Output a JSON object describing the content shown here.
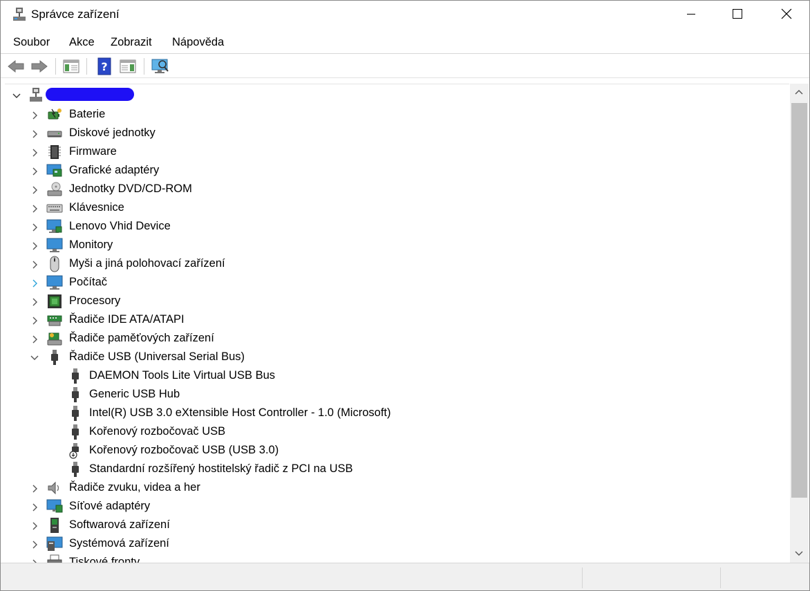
{
  "window": {
    "title": "Správce zařízení"
  },
  "menu": {
    "file": "Soubor",
    "action": "Akce",
    "view": "Zobrazit",
    "help": "Nápověda"
  },
  "tree": {
    "categories": [
      {
        "label": "Baterie",
        "icon": "battery-icon"
      },
      {
        "label": "Diskové jednotky",
        "icon": "disk-drive-icon"
      },
      {
        "label": "Firmware",
        "icon": "firmware-icon"
      },
      {
        "label": "Grafické adaptéry",
        "icon": "display-adapter-icon"
      },
      {
        "label": "Jednotky DVD/CD-ROM",
        "icon": "dvd-drive-icon"
      },
      {
        "label": "Klávesnice",
        "icon": "keyboard-icon"
      },
      {
        "label": "Lenovo Vhid Device",
        "icon": "monitor-network-icon"
      },
      {
        "label": "Monitory",
        "icon": "monitor-icon"
      },
      {
        "label": "Myši a jiná polohovací zařízení",
        "icon": "mouse-icon"
      },
      {
        "label": "Počítač",
        "icon": "computer-icon"
      },
      {
        "label": "Procesory",
        "icon": "processor-icon"
      },
      {
        "label": "Řadiče IDE ATA/ATAPI",
        "icon": "ide-controller-icon"
      },
      {
        "label": "Řadiče paměťových zařízení",
        "icon": "storage-controller-icon"
      },
      {
        "label": "Řadiče USB (Universal Serial Bus)",
        "icon": "usb-icon",
        "expanded": true
      },
      {
        "label": "Řadiče zvuku, videa a her",
        "icon": "speaker-icon"
      },
      {
        "label": "Síťové adaptéry",
        "icon": "network-adapter-icon"
      },
      {
        "label": "Softwarová zařízení",
        "icon": "software-device-icon"
      },
      {
        "label": "Systémová zařízení",
        "icon": "system-device-icon"
      },
      {
        "label": "Tiskové fronty",
        "icon": "printer-icon"
      }
    ],
    "usb_children": [
      {
        "label": "DAEMON Tools Lite Virtual USB Bus",
        "icon": "usb-plug-icon"
      },
      {
        "label": "Generic USB Hub",
        "icon": "usb-plug-icon"
      },
      {
        "label": "Intel(R) USB 3.0 eXtensible Host Controller - 1.0 (Microsoft)",
        "icon": "usb-plug-icon"
      },
      {
        "label": "Kořenový rozbočovač USB",
        "icon": "usb-plug-icon"
      },
      {
        "label": "Kořenový rozbočovač USB (USB 3.0)",
        "icon": "usb-plug-disabled-icon"
      },
      {
        "label": "Standardní rozšířený hostitelský řadič z PCI na USB",
        "icon": "usb-plug-icon"
      }
    ]
  },
  "colors": {
    "accent": "#0078d7",
    "redaction": "#1e10f5",
    "scrollbar_thumb": "#c1c1c1"
  }
}
